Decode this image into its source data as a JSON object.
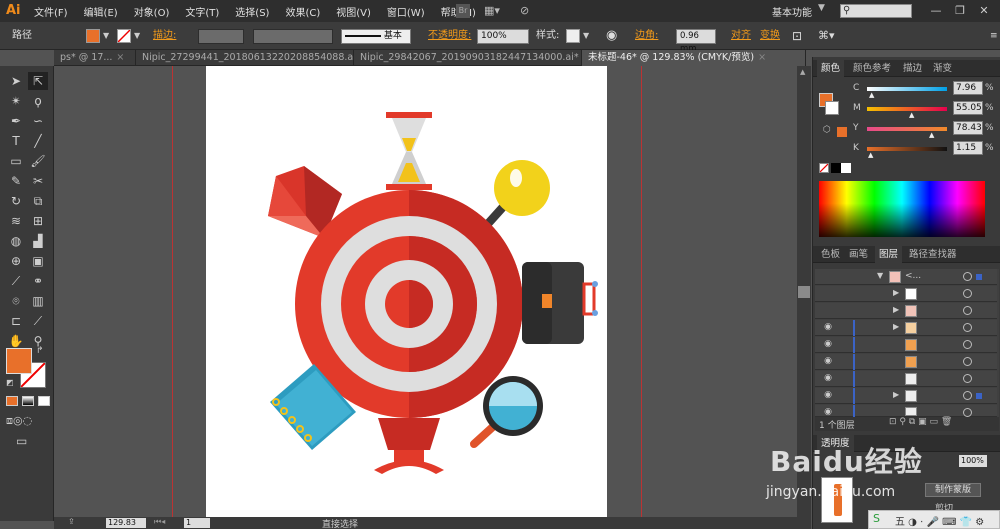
{
  "app": {
    "logo": "Ai",
    "workspace": "基本功能",
    "search_placeholder": ""
  },
  "menus": [
    "文件(F)",
    "编辑(E)",
    "对象(O)",
    "文字(T)",
    "选择(S)",
    "效果(C)",
    "视图(V)",
    "窗口(W)",
    "帮助(H)"
  ],
  "menubar_icons": {
    "br_label": "Br"
  },
  "control": {
    "path_label": "路径",
    "stroke_label": "描边:",
    "brush_label": "基本",
    "opacity_label": "不透明度:",
    "opacity_value": "100%",
    "style_label": "样式:",
    "corner_label": "边角:",
    "corner_value": "0.96 mm",
    "align_label": "对齐",
    "transform_label": "变换"
  },
  "tabs": [
    {
      "label": "ps* @ 17...",
      "active": false
    },
    {
      "label": "Nipic_27299441_20180613220208854088.ai*",
      "active": false
    },
    {
      "label": "Nipic_29842067_20190903182447134000.ai*",
      "active": false
    },
    {
      "label": "未标题-46* @ 129.83% (CMYK/预览)",
      "active": true
    }
  ],
  "color_panel": {
    "tabs": [
      "颜色",
      "颜色参考",
      "描边",
      "渐变"
    ],
    "sliders": [
      {
        "name": "C",
        "value": "7.96",
        "pct": "%",
        "level": 0.08
      },
      {
        "name": "M",
        "value": "55.05",
        "pct": "%",
        "level": 0.55
      },
      {
        "name": "Y",
        "value": "78.43",
        "pct": "%",
        "level": 0.78
      },
      {
        "name": "K",
        "value": "1.15",
        "pct": "%",
        "level": 0.01
      }
    ]
  },
  "layers_panel": {
    "tabs": [
      "色板",
      "画笔",
      "图层",
      "路径查找器"
    ],
    "top_label": "<...",
    "status": "1 个图层",
    "row_count": 9
  },
  "bottom_panel": {
    "tabs": [
      "透明度"
    ],
    "value": "100%",
    "make_mask": "制作蒙版",
    "clip": "剪切"
  },
  "status": {
    "zoom": "129.83",
    "page": "1",
    "tool": "直接选择"
  },
  "watermark": {
    "line1": "Baidu经验",
    "line2": "jingyan.baidu.com"
  },
  "colors": {
    "fill": "#e8702a",
    "accent": "#f29a1a",
    "target_red": "#e23a2a",
    "target_dark": "#c62b23",
    "ring_light": "#dedede"
  }
}
